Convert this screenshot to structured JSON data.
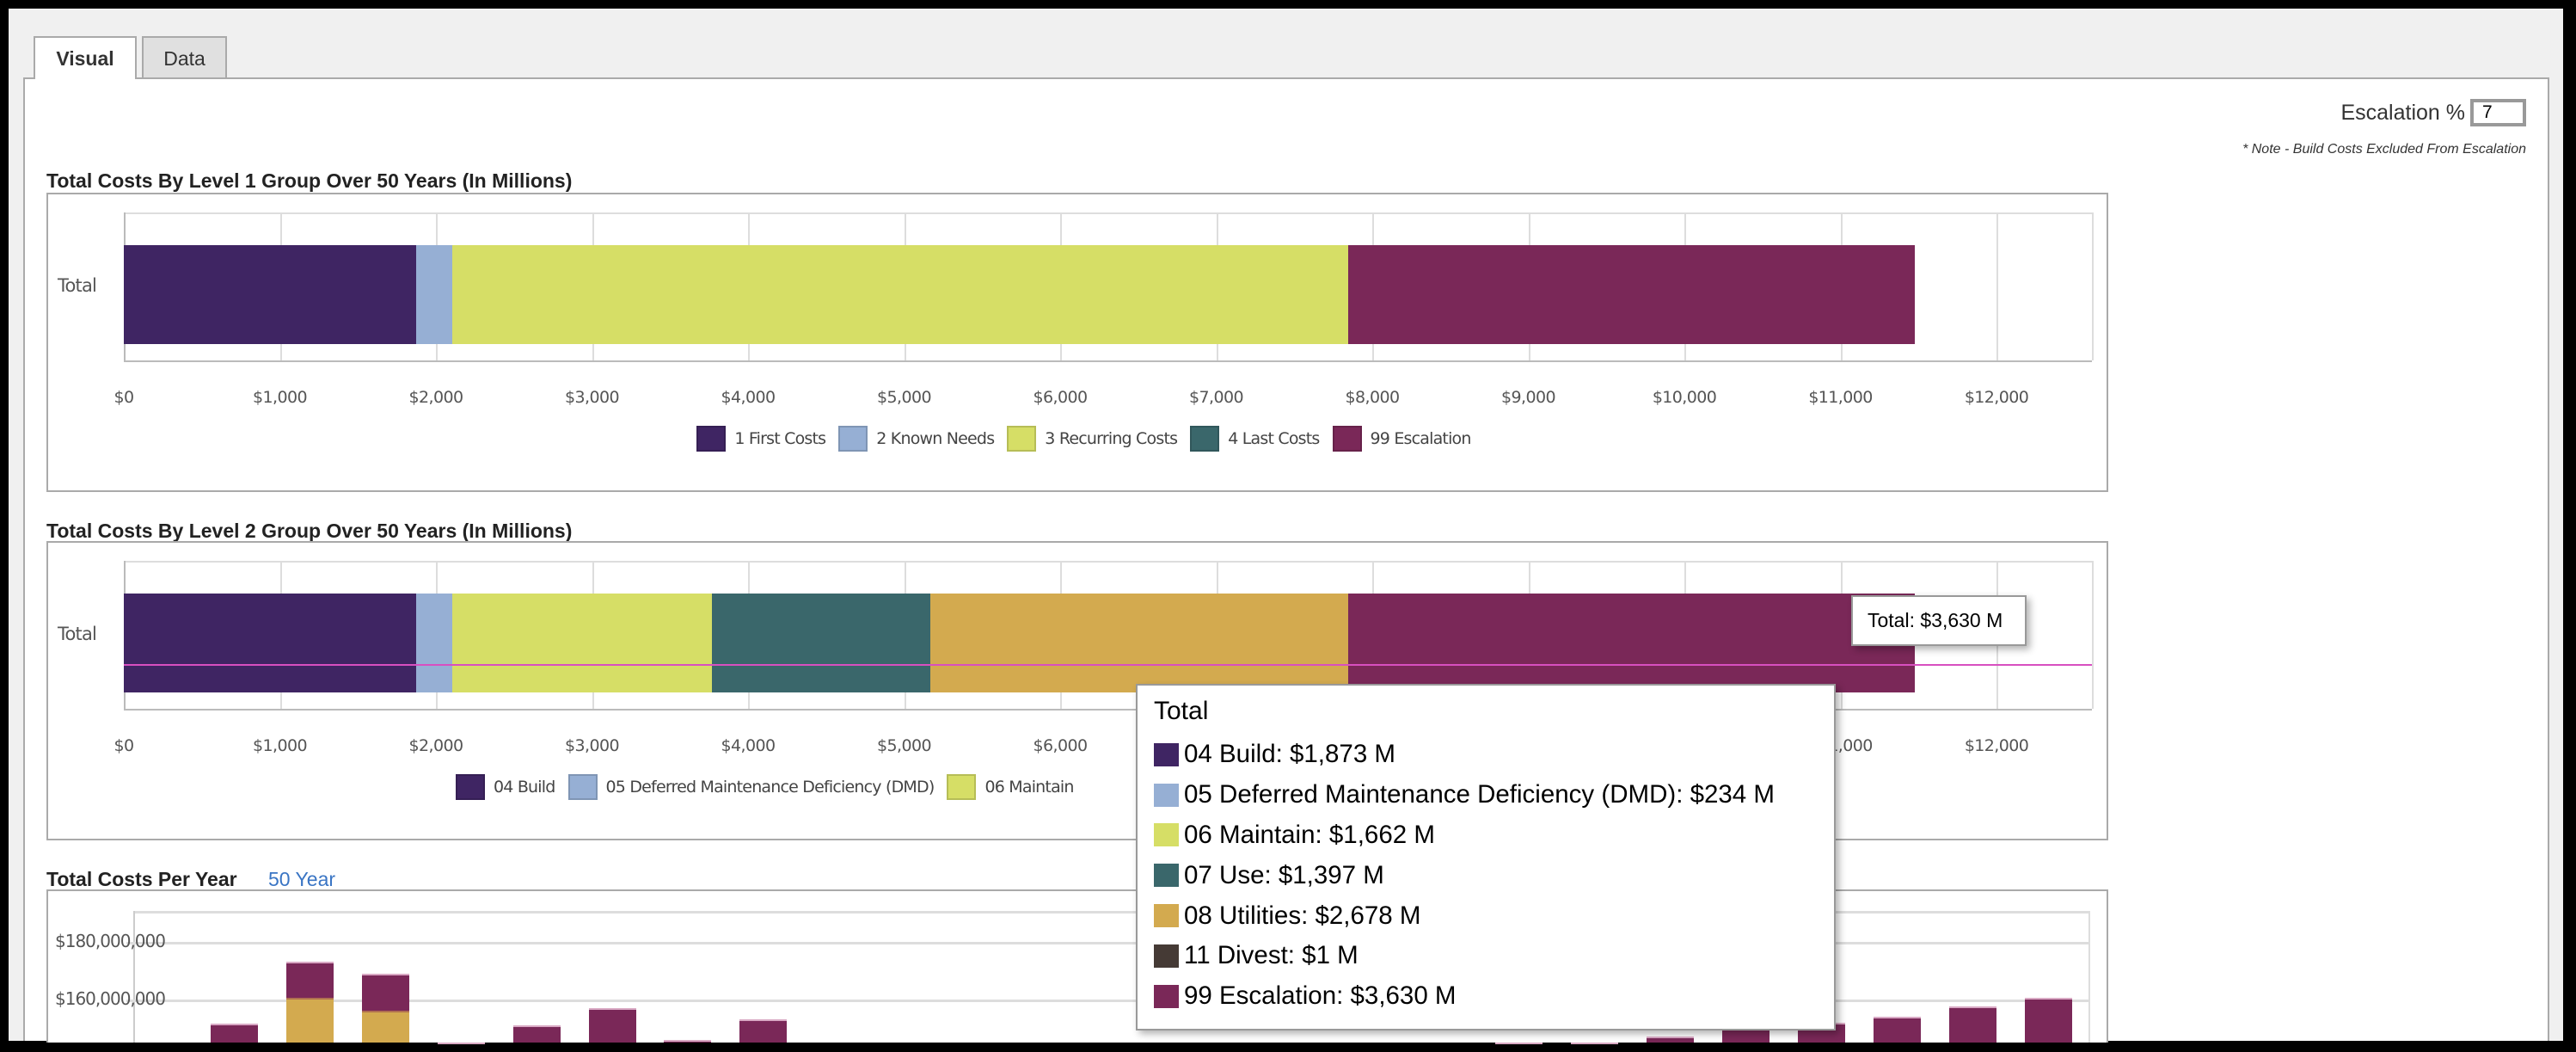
{
  "tabs": [
    {
      "label": "Visual",
      "active": true
    },
    {
      "label": "Data",
      "active": false
    }
  ],
  "escalation": {
    "label": "Escalation %",
    "value": "7",
    "note": "* Note - Build Costs Excluded From Escalation"
  },
  "colors": {
    "build": "#3f2563",
    "dmd": "#96afd4",
    "maintain": "#d6de66",
    "use": "#3a676b",
    "utilities": "#d3aa4f",
    "divest": "#453a35",
    "escalation": "#7a2858",
    "crosshair": "#d84fc0",
    "link": "#3a75c4"
  },
  "chart_data": [
    {
      "type": "bar",
      "orientation": "horizontal",
      "stacked": true,
      "title": "Total Costs By Level 1 Group Over 50 Years (In Millions)",
      "categories": [
        "Total"
      ],
      "xlim": [
        0,
        12600
      ],
      "xticks": [
        "$0",
        "$1,000",
        "$2,000",
        "$3,000",
        "$4,000",
        "$5,000",
        "$6,000",
        "$7,000",
        "$8,000",
        "$9,000",
        "$10,000",
        "$11,000",
        "$12,000"
      ],
      "legend_position": "bottom",
      "series": [
        {
          "name": "1 First Costs",
          "values": [
            1873
          ],
          "color": "#3f2563"
        },
        {
          "name": "2 Known Needs",
          "values": [
            234
          ],
          "color": "#96afd4"
        },
        {
          "name": "3 Recurring Costs",
          "values": [
            5737
          ],
          "color": "#d6de66"
        },
        {
          "name": "4 Last Costs",
          "values": [
            1
          ],
          "color": "#3a676b"
        },
        {
          "name": "99 Escalation",
          "values": [
            3630
          ],
          "color": "#7a2858"
        }
      ]
    },
    {
      "type": "bar",
      "orientation": "horizontal",
      "stacked": true,
      "title": "Total Costs By Level 2 Group Over 50 Years (In Millions)",
      "categories": [
        "Total"
      ],
      "xlim": [
        0,
        12600
      ],
      "xticks": [
        "$0",
        "$1,000",
        "$2,000",
        "$3,000",
        "$4,000",
        "$5,000",
        "$6,000",
        "$7,000",
        "$8,000",
        "$9,000",
        "$10,000",
        "$11,000",
        "$12,000"
      ],
      "legend_position": "bottom",
      "legend_visible": [
        "04 Build",
        "05 Deferred Maintenance Deficiency (DMD)",
        "06 Maintain"
      ],
      "series": [
        {
          "name": "04 Build",
          "values": [
            1873
          ],
          "color": "#3f2563"
        },
        {
          "name": "05 Deferred Maintenance Deficiency (DMD)",
          "values": [
            234
          ],
          "color": "#96afd4"
        },
        {
          "name": "06 Maintain",
          "values": [
            1662
          ],
          "color": "#d6de66"
        },
        {
          "name": "07 Use",
          "values": [
            1397
          ],
          "color": "#3a676b"
        },
        {
          "name": "08 Utilities",
          "values": [
            2678
          ],
          "color": "#d3aa4f"
        },
        {
          "name": "11 Divest",
          "values": [
            1
          ],
          "color": "#453a35"
        },
        {
          "name": "99 Escalation",
          "values": [
            3630
          ],
          "color": "#7a2858"
        }
      ],
      "hover_label": "Total: $3,630 M",
      "tooltip": {
        "title": "Total",
        "rows": [
          {
            "label": "04 Build: $1,873 M",
            "color": "#3f2563"
          },
          {
            "label": "05 Deferred Maintenance Deficiency (DMD): $234 M",
            "color": "#96afd4"
          },
          {
            "label": "06 Maintain: $1,662 M",
            "color": "#d6de66"
          },
          {
            "label": "07 Use: $1,397 M",
            "color": "#3a676b"
          },
          {
            "label": "08 Utilities: $2,678 M",
            "color": "#d3aa4f"
          },
          {
            "label": "11 Divest: $1 M",
            "color": "#453a35"
          },
          {
            "label": "99 Escalation: $3,630 M",
            "color": "#7a2858"
          }
        ]
      }
    },
    {
      "type": "bar",
      "orientation": "vertical",
      "stacked": true,
      "title": "Total Costs Per Year",
      "period_link": "50 Year",
      "yticks": [
        {
          "label": "$180,000,000",
          "value": 180000000
        },
        {
          "label": "$160,000,000",
          "value": 160000000
        }
      ],
      "ylim_visible": [
        140000000,
        190000000
      ],
      "series": [
        {
          "name": "08 Utilities",
          "color": "#d3aa4f",
          "values": [
            null,
            160600000,
            156000000,
            null,
            null,
            null,
            null,
            null,
            null,
            null,
            null,
            null,
            null,
            null,
            null,
            null,
            null,
            null,
            null,
            null,
            null,
            null,
            null,
            null,
            null
          ]
        },
        {
          "name": "99 Escalation",
          "color": "#7a2858",
          "values": [
            151500000,
            173000000,
            169000000,
            145000000,
            151000000,
            157000000,
            146000000,
            153000000,
            null,
            null,
            null,
            null,
            null,
            null,
            null,
            null,
            null,
            145000000,
            145000000,
            147000000,
            150000000,
            152000000,
            154000000,
            157700000,
            160600000
          ]
        }
      ]
    }
  ]
}
